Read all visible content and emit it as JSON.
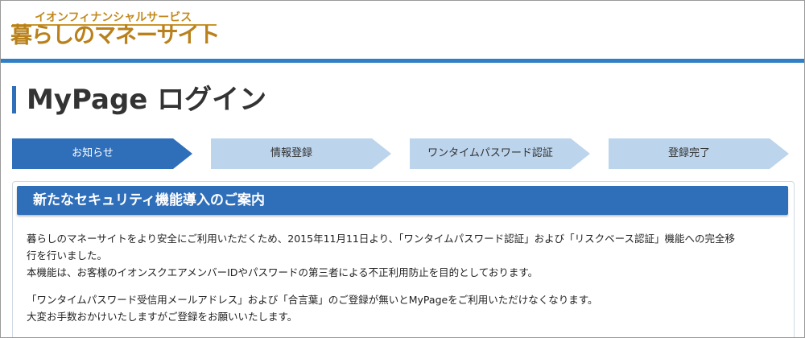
{
  "logo": {
    "company": "イオンフィナンシャルサービス",
    "site_name": "暮らしのマネーサイト"
  },
  "page": {
    "title": "MyPage ログイン"
  },
  "steps": [
    {
      "label": "お知らせ",
      "active": true
    },
    {
      "label": "情報登録",
      "active": false
    },
    {
      "label": "ワンタイムパスワード認証",
      "active": false
    },
    {
      "label": "登録完了",
      "active": false
    }
  ],
  "notice": {
    "title": "新たなセキュリティ機能導入のご案内",
    "paragraph1": {
      "line1": "暮らしのマネーサイトをより安全にご利用いただくため、2015年11月11日より、「ワンタイムパスワード認証」および「リスクベース認証」機能への完全移",
      "line2": "行を行いました。",
      "line3": "本機能は、お客様のイオンスクエアメンバーIDやパスワードの第三者による不正利用防止を目的としております。"
    },
    "paragraph2": {
      "line1": "「ワンタイムパスワード受信用メールアドレス」および「合言葉」のご登録が無いとMyPageをご利用いただけなくなります。",
      "line2": "大変お手数おかけいたしますがご登録をお願いいたします。"
    }
  },
  "colors": {
    "brand_gold": "#b9811b",
    "header_bar": "#2f7fc6",
    "step_active": "#2f6fba",
    "step_inactive": "#bcd4ec",
    "notice_header": "#2f6fba"
  }
}
